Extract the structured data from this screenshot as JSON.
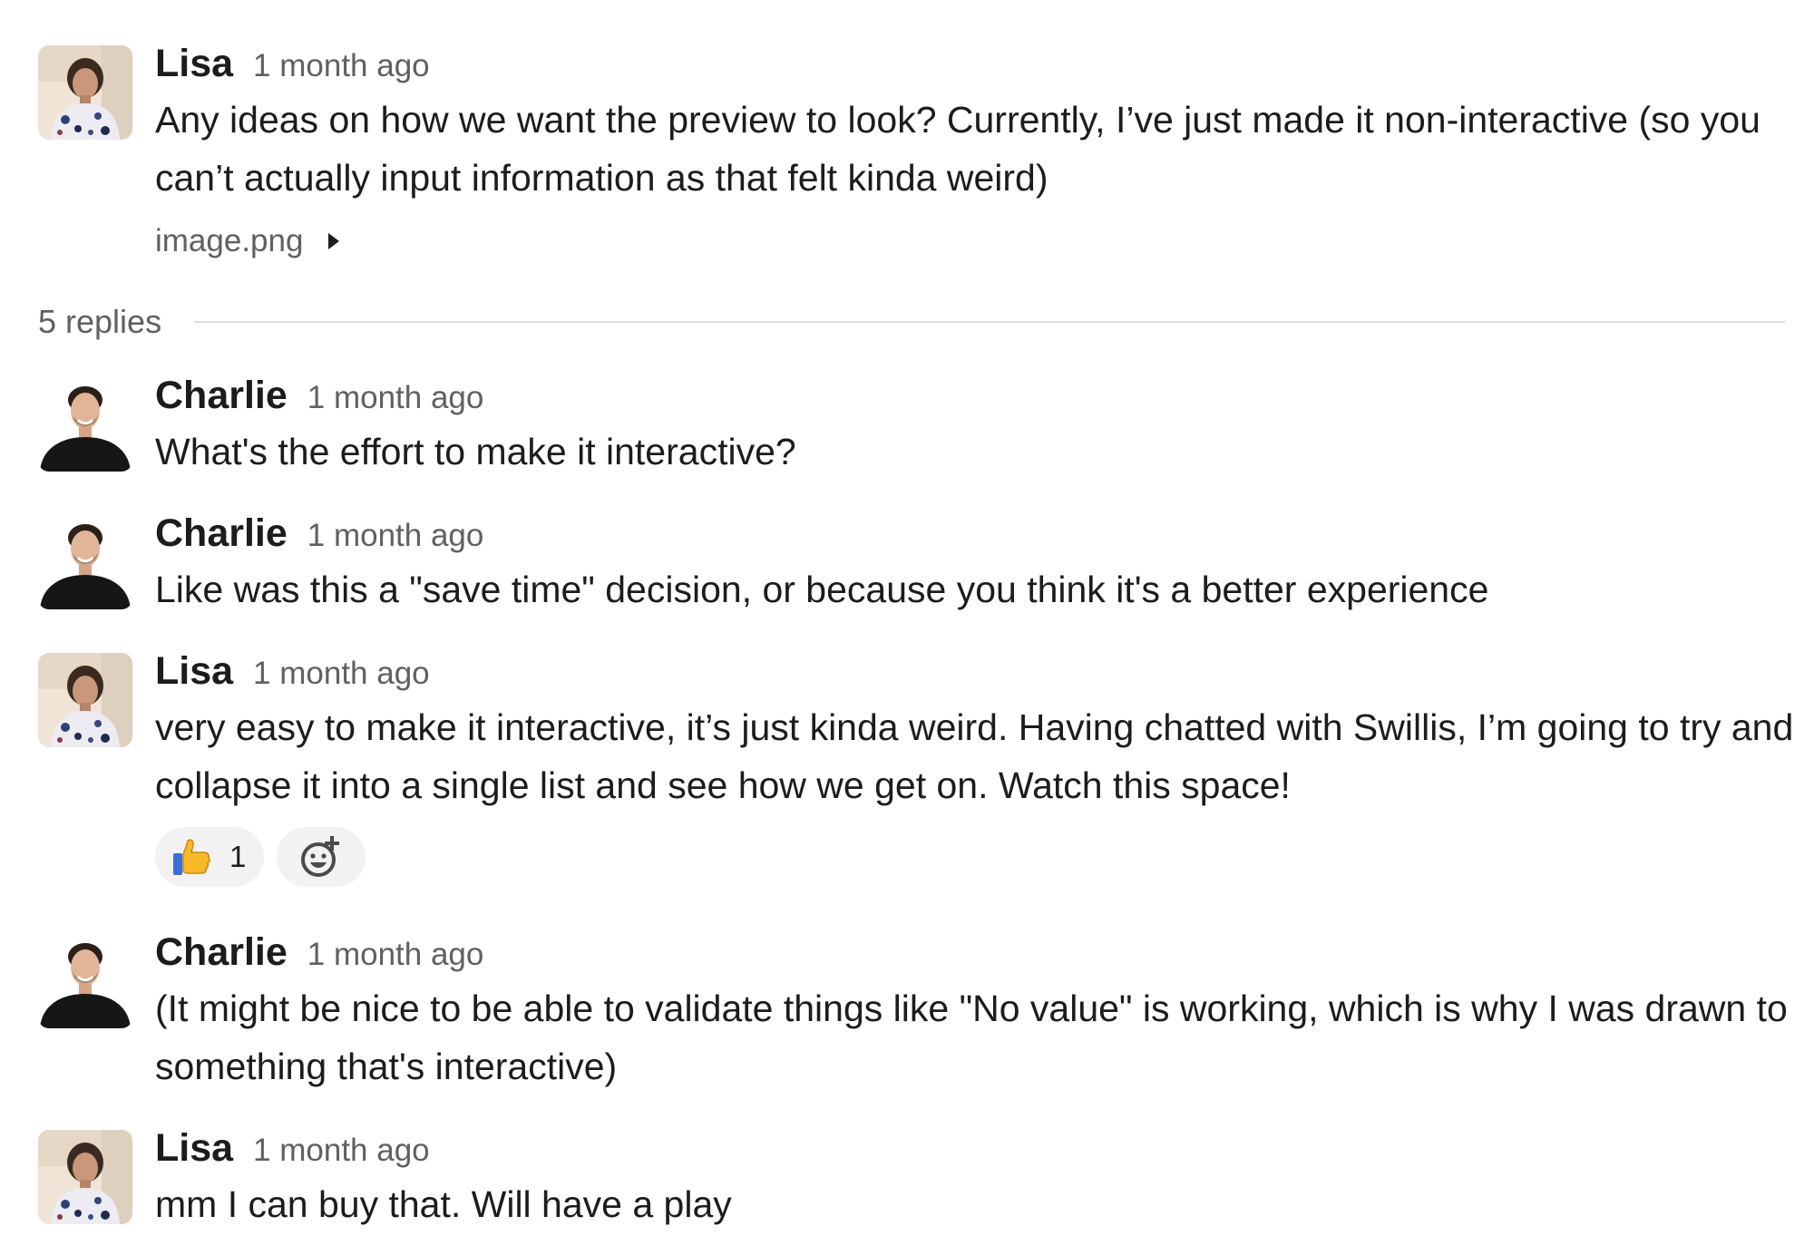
{
  "parent": {
    "author": "Lisa",
    "timestamp": "1 month ago",
    "text": "Any ideas on how we want the preview to look? Currently, I’ve just made it non-interactive (so you can’t actually input information as that felt kinda weird)",
    "attachment": {
      "name": "image.png",
      "icon": "caret-right-icon"
    }
  },
  "replies_label": "5 replies",
  "replies": [
    {
      "author": "Charlie",
      "timestamp": "1 month ago",
      "text": "What's the effort to make it interactive?"
    },
    {
      "author": "Charlie",
      "timestamp": "1 month ago",
      "text": "Like was this a \"save time\" decision, or because you think it's a better experience"
    },
    {
      "author": "Lisa",
      "timestamp": "1 month ago",
      "text": "very easy to make it interactive, it’s just kinda weird. Having chatted with Swillis, I’m going to try and collapse it into a single list and see how we get on. Watch this space!",
      "reactions": [
        {
          "emoji": "thumbs-up",
          "count": "1"
        }
      ],
      "add_reaction_icon": "add-emoji-icon"
    },
    {
      "author": "Charlie",
      "timestamp": "1 month ago",
      "text": "(It might be nice to be able to validate things like \"No value\" is working, which is why I was drawn to something that's interactive)"
    },
    {
      "author": "Lisa",
      "timestamp": "1 month ago",
      "text": "mm I can buy that. Will have a play"
    }
  ],
  "colors": {
    "text": "#1d1c1d",
    "muted": "#616061",
    "divider": "#dddddd",
    "pill_bg": "#f2f2f2",
    "lisa_shirt": "#e9e9f1",
    "charlie_shirt": "#1a1a1a"
  }
}
